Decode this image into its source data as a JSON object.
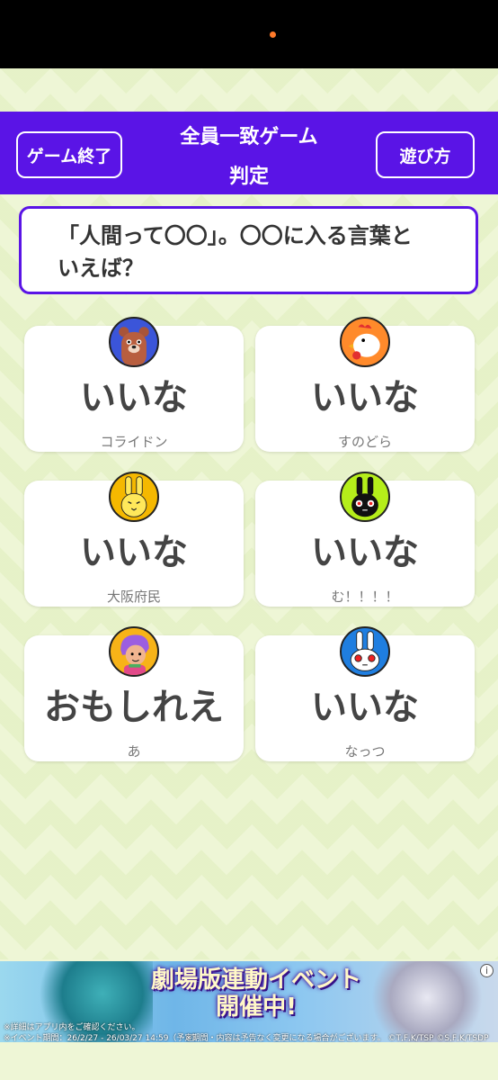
{
  "header": {
    "end_button": "ゲーム終了",
    "title_line1": "全員一致ゲーム",
    "title_line2": "判定",
    "howto_button": "遊び方"
  },
  "question": {
    "line1": "「人間って〇〇」。〇〇に入る言葉と",
    "line2": "いえば？"
  },
  "cards": [
    {
      "answer": "いいな",
      "name": "コライドン",
      "avatar_icon": "bear-avatar-icon"
    },
    {
      "answer": "いいな",
      "name": "すのどら",
      "avatar_icon": "chicken-avatar-icon"
    },
    {
      "answer": "いいな",
      "name": "大阪府民",
      "avatar_icon": "yellow-rabbit-avatar-icon"
    },
    {
      "answer": "いいな",
      "name": "む！！！！",
      "avatar_icon": "black-rabbit-avatar-icon"
    },
    {
      "answer": "おもしれえ",
      "name": "あ",
      "avatar_icon": "purple-hair-person-avatar-icon"
    },
    {
      "answer": "いいな",
      "name": "なっつ",
      "avatar_icon": "white-rabbit-avatar-icon"
    }
  ],
  "ad": {
    "title_line1": "劇場版連動イベント",
    "title_line2": "開催中!",
    "note1": "※詳細はアプリ内をご確認ください。",
    "note2": "※イベント期間：26/2/27 - 26/03/27 14:59（予定）",
    "note3": "※期間・内容は予告なく変更になる場合がございます。 ©T,F,K/TSP ©S,F,K/TSDP ©B-Ed",
    "info_icon": "i"
  },
  "colors": {
    "header_purple": "#5a14e6",
    "background": "#eef6d6"
  }
}
